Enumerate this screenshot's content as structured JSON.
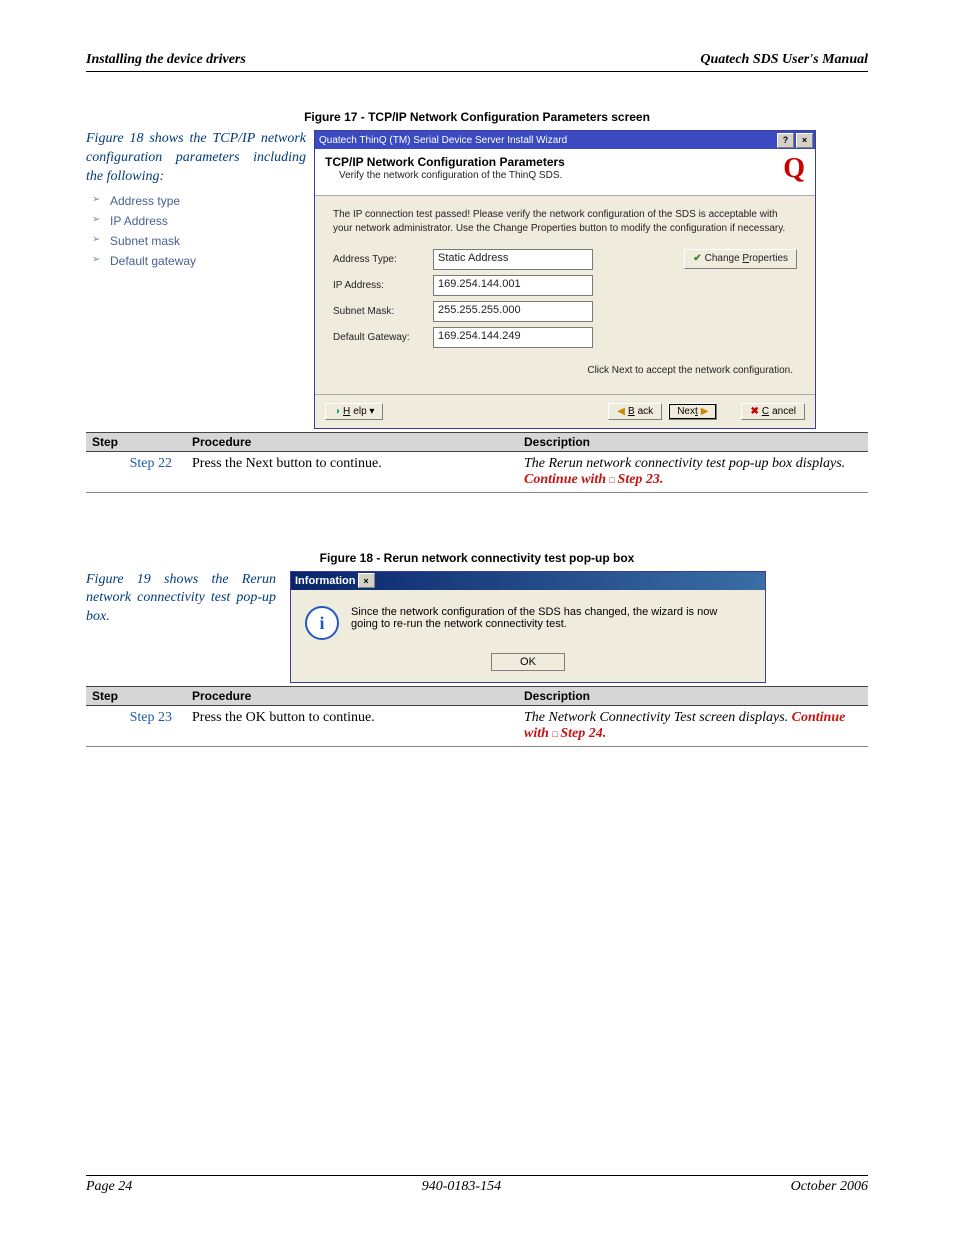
{
  "header": {
    "left": "Installing the device drivers",
    "right": "Quatech SDS User's Manual"
  },
  "footer": {
    "left": "Page 24",
    "center": "940-0183-154",
    "right": "October 2006"
  },
  "figure17": {
    "caption": "Figure 17 - TCP/IP Network Configuration Parameters screen",
    "sidebar_intro": "Figure 18 shows the TCP/IP network configuration parameters including the following:",
    "bullets": [
      "Address type",
      "IP Address",
      "Subnet mask",
      "Default gateway"
    ]
  },
  "wizard": {
    "title": "Quatech ThinQ (TM) Serial Device Server Install Wizard",
    "head_title": "TCP/IP Network Configuration Parameters",
    "head_sub": "Verify the network configuration of the ThinQ SDS.",
    "msg": "The IP connection test passed!  Please verify the network configuration of the SDS is acceptable with your network administrator.  Use the Change Properties button to modify the configuration if necessary.",
    "params": {
      "addr_type_label": "Address Type:",
      "addr_type": "Static Address",
      "ip_label": "IP Address:",
      "ip": "169.254.144.001",
      "mask_label": "Subnet Mask:",
      "mask": "255.255.255.000",
      "gw_label": "Default Gateway:",
      "gw": "169.254.144.249"
    },
    "change_btn": "Change Properties",
    "hint": "Click Next to accept the network configuration.",
    "help": "Help",
    "back": "Back",
    "next": "Next",
    "cancel": "Cancel"
  },
  "table1": {
    "headers": {
      "step": "Step",
      "proc": "Procedure",
      "desc": "Description"
    },
    "step_label": "Step 22",
    "procedure": "Press the Next button to continue.",
    "desc_line1": "The Rerun network connectivity test pop-up box displays.",
    "desc_cont_prefix": "Continue with ",
    "desc_cont_link": "Step 23."
  },
  "figure18": {
    "caption": "Figure 18 - Rerun network connectivity test pop-up box",
    "sidebar_intro": "Figure 19 shows the Rerun network connectivity test pop-up box."
  },
  "info": {
    "title": "Information",
    "msg": "Since the network configuration of the SDS has changed, the wizard is now going to re-run the network connectivity test.",
    "ok": "OK"
  },
  "table2": {
    "step_label": "Step 23",
    "procedure": "Press the OK button to continue.",
    "desc_line1": "The Network Connectivity Test screen displays. ",
    "desc_cont_prefix": "Continue with ",
    "desc_cont_link": "Step 24."
  }
}
